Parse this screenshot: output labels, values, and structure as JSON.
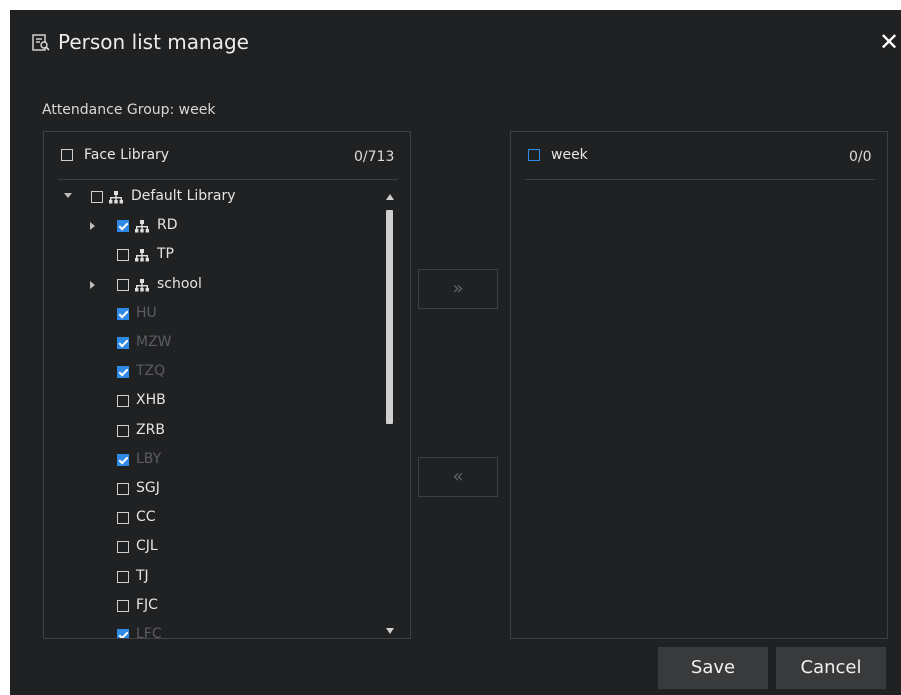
{
  "dialog": {
    "title": "Person list manage",
    "close_label": "✕",
    "group_label": "Attendance Group: week"
  },
  "left": {
    "header_label": "Face Library",
    "count": "0/713"
  },
  "right": {
    "header_label": "week",
    "count": "0/0"
  },
  "tree": [
    {
      "label": "Default Library",
      "level": 0,
      "checked": false,
      "expander": "expanded",
      "icon": "org-icon",
      "dim": false
    },
    {
      "label": "RD",
      "level": 1,
      "checked": true,
      "expander": "collapsed",
      "icon": "org-icon",
      "dim": false
    },
    {
      "label": "TP",
      "level": 1,
      "checked": false,
      "expander": "none",
      "icon": "org-icon",
      "dim": false
    },
    {
      "label": "school",
      "level": 1,
      "checked": false,
      "expander": "collapsed",
      "icon": "org-icon",
      "dim": false
    },
    {
      "label": "HU",
      "level": 1,
      "checked": true,
      "expander": "none",
      "icon": "",
      "dim": true
    },
    {
      "label": "MZW",
      "level": 1,
      "checked": true,
      "expander": "none",
      "icon": "",
      "dim": true
    },
    {
      "label": "TZQ",
      "level": 1,
      "checked": true,
      "expander": "none",
      "icon": "",
      "dim": true
    },
    {
      "label": "XHB",
      "level": 1,
      "checked": false,
      "expander": "none",
      "icon": "",
      "dim": false
    },
    {
      "label": "ZRB",
      "level": 1,
      "checked": false,
      "expander": "none",
      "icon": "",
      "dim": false
    },
    {
      "label": "LBY",
      "level": 1,
      "checked": true,
      "expander": "none",
      "icon": "",
      "dim": true
    },
    {
      "label": "SGJ",
      "level": 1,
      "checked": false,
      "expander": "none",
      "icon": "",
      "dim": false
    },
    {
      "label": "CC",
      "level": 1,
      "checked": false,
      "expander": "none",
      "icon": "",
      "dim": false
    },
    {
      "label": "CJL",
      "level": 1,
      "checked": false,
      "expander": "none",
      "icon": "",
      "dim": false
    },
    {
      "label": "TJ",
      "level": 1,
      "checked": false,
      "expander": "none",
      "icon": "",
      "dim": false
    },
    {
      "label": "FJC",
      "level": 1,
      "checked": false,
      "expander": "none",
      "icon": "",
      "dim": false
    },
    {
      "label": "LFC",
      "level": 1,
      "checked": true,
      "expander": "none",
      "icon": "",
      "dim": true
    },
    {
      "label": "",
      "level": 1,
      "checked": false,
      "expander": "none",
      "icon": "",
      "dim": false
    }
  ],
  "buttons": {
    "add_label": "»",
    "remove_label": "«",
    "save_label": "Save",
    "cancel_label": "Cancel"
  },
  "colors": {
    "background": "#202122",
    "accent": "#2f8ae5",
    "border": "#3e4042",
    "button": "#393a3c"
  }
}
